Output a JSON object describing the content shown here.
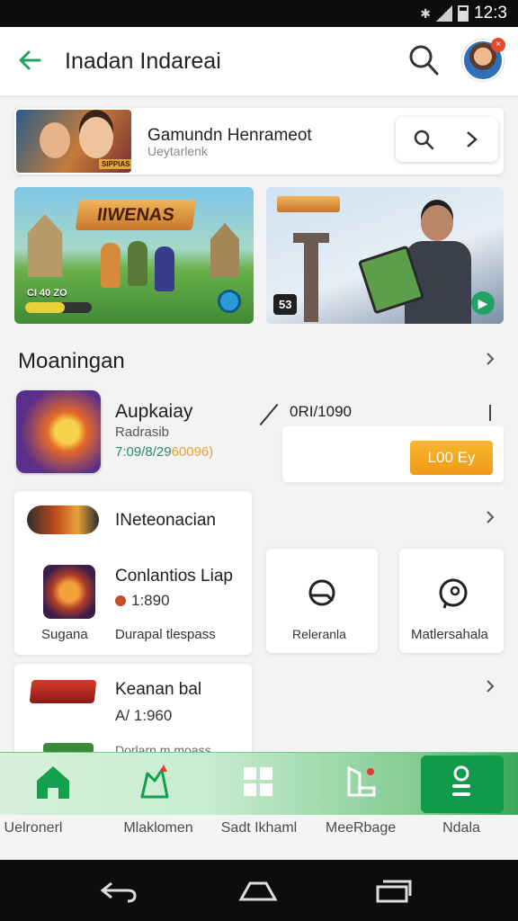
{
  "status": {
    "time": "12:3"
  },
  "appbar": {
    "title": "Inadan Indareai",
    "avatar_badge": "×"
  },
  "featured": {
    "title": "Gamundn Henrameot",
    "subtitle": "Ueytarlenk",
    "thumb_tag": "SIPPIAS"
  },
  "banners": [
    {
      "logo": "IIWENAS",
      "label": "CI 40 ZO"
    },
    {
      "badge": "53"
    }
  ],
  "section": {
    "title": "Moaningan"
  },
  "app_row": {
    "name": "Aupkaiay",
    "category": "Radrasib",
    "meta_prefix": "7:09/8/29",
    "meta_highlight": "60096)",
    "count": "0RI/1090",
    "install_label": "L00 Ey"
  },
  "card_a": {
    "title": "INeteonacian",
    "game_title": "Conlantios Liap",
    "game_value": "1:890",
    "left_label": "Sugana",
    "right_label": "Durapal tlespass"
  },
  "card_b": {
    "label": "Releranla"
  },
  "card_c": {
    "label": "Matlersahala"
  },
  "card_d": {
    "title": "Keanan bal",
    "value": "A/ 1:960",
    "partial": "Dorlarn m moass"
  },
  "bottom_nav": [
    {
      "label": "Uelronerl",
      "icon": "home-icon"
    },
    {
      "label": "Mlaklomen",
      "icon": "map-pin-icon"
    },
    {
      "label": "Sadt Ikhaml",
      "icon": "grid-icon"
    },
    {
      "label": "MeeRbage",
      "icon": "tools-icon"
    },
    {
      "label": "Ndala",
      "icon": "profile-icon"
    }
  ],
  "colors": {
    "accent": "#129a4b",
    "install": "#f5a623"
  }
}
